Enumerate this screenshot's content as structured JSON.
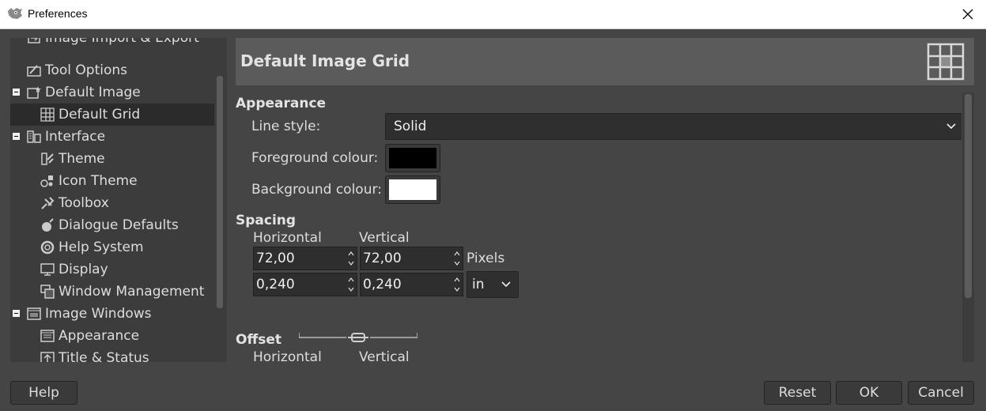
{
  "window": {
    "title": "Preferences"
  },
  "tree": {
    "items": [
      {
        "label": "Image Import & Export",
        "name": "tree-item-image-import-export"
      },
      {
        "label": "Tool Options",
        "name": "tree-item-tool-options"
      },
      {
        "label": "Default Image",
        "name": "tree-item-default-image"
      },
      {
        "label": "Default Grid",
        "name": "tree-item-default-grid",
        "selected": true
      },
      {
        "label": "Interface",
        "name": "tree-item-interface"
      },
      {
        "label": "Theme",
        "name": "tree-item-theme"
      },
      {
        "label": "Icon Theme",
        "name": "tree-item-icon-theme"
      },
      {
        "label": "Toolbox",
        "name": "tree-item-toolbox"
      },
      {
        "label": "Dialogue Defaults",
        "name": "tree-item-dialogue-defaults"
      },
      {
        "label": "Help System",
        "name": "tree-item-help-system"
      },
      {
        "label": "Display",
        "name": "tree-item-display"
      },
      {
        "label": "Window Management",
        "name": "tree-item-window-management"
      },
      {
        "label": "Image Windows",
        "name": "tree-item-image-windows"
      },
      {
        "label": "Appearance",
        "name": "tree-item-appearance"
      },
      {
        "label": "Title & Status",
        "name": "tree-item-title-status"
      }
    ]
  },
  "page": {
    "title": "Default Image Grid",
    "appearance": {
      "heading": "Appearance",
      "line_style_label": "Line style:",
      "line_style_value": "Solid",
      "fg_label": "Foreground colour:",
      "fg_color": "#000000",
      "bg_label": "Background colour:",
      "bg_color": "#ffffff"
    },
    "spacing": {
      "heading": "Spacing",
      "horizontal_label": "Horizontal",
      "vertical_label": "Vertical",
      "h_pixels": "72,00",
      "v_pixels": "72,00",
      "pixels_unit": "Pixels",
      "h_in": "0,240",
      "v_in": "0,240",
      "unit_value": "in"
    },
    "offset": {
      "heading": "Offset",
      "horizontal_label": "Horizontal",
      "vertical_label": "Vertical"
    }
  },
  "buttons": {
    "help": "Help",
    "reset": "Reset",
    "ok": "OK",
    "cancel": "Cancel"
  },
  "colors": {
    "background": "#454545",
    "tree_bg": "#3c3c3c",
    "selected_bg": "#2b2b2b",
    "header_bg": "#5b5b5b",
    "text": "#dddddd"
  }
}
